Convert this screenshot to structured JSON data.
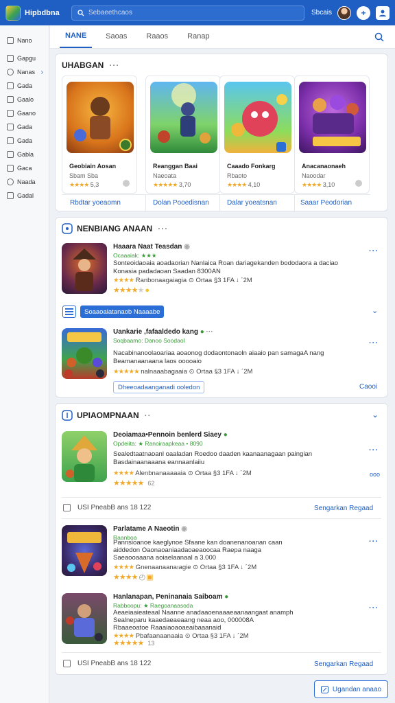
{
  "header": {
    "brand": "Hipbdbna",
    "search_placeholder": "Sebaeethcaos",
    "user_name": "Sbcais",
    "plus_label": "+"
  },
  "sidebar": {
    "items": [
      {
        "label": "Nano",
        "icon": "grid-icon"
      },
      {
        "label": "Gapgu",
        "icon": "folder-icon"
      },
      {
        "label": "Nanas",
        "icon": "circle-icon",
        "active": true
      },
      {
        "label": "Gada",
        "icon": "list-icon"
      },
      {
        "label": "Gaalo",
        "icon": "doc-icon"
      },
      {
        "label": "Gaano",
        "icon": "doc-icon"
      },
      {
        "label": "Gada",
        "icon": "edit-icon"
      },
      {
        "label": "Gada",
        "icon": "bookmark-icon"
      },
      {
        "label": "Gabla",
        "icon": "doc-icon"
      },
      {
        "label": "Gaca",
        "icon": "doc-icon"
      },
      {
        "label": "Naada",
        "icon": "circle-icon"
      },
      {
        "label": "Gadal",
        "icon": "list-icon"
      }
    ]
  },
  "tabs": [
    {
      "label": "NANE",
      "active": true
    },
    {
      "label": "Saoas"
    },
    {
      "label": "Raaos"
    },
    {
      "label": "Ranap"
    }
  ],
  "featured": {
    "title": "UHABGAN",
    "cards": [
      {
        "name": "Geobiain Aosan",
        "sub": "Sbam Sba",
        "rating": "5,3",
        "link": "Rbdtar yoeaomn"
      },
      {
        "name": "Reanggan Baai",
        "sub": "Naeoata",
        "rating": "3,70",
        "link": "Dolan Pooedisnan"
      },
      {
        "name": "Caaado Fonkarg",
        "sub": "Rbaoto",
        "rating": "4,10",
        "link": "Dalar yoeatsnan"
      },
      {
        "name": "Anacanaonaeh",
        "sub": "Naoodar",
        "rating": "3,10",
        "link": "Saaar Peodorian"
      }
    ]
  },
  "section2": {
    "title": "NENBIANG ANAAN",
    "item1": {
      "title": "Haaara Naat Teasdan",
      "dev": "Ocaaaiak: ★★★",
      "desc1": "Sonteoidaoaia aoadaorian Nanlaica Roan dariagekanden bododaora a daciao",
      "desc2": "Konasia padadaoan Saadan 8300AN",
      "meta": "Ranbonaagaiagia  ⊙ Ortaa  §3 1FA  ↓ ´2M"
    },
    "chip": "Soaaoaiatanaob Naaaabe",
    "item2": {
      "title": "Uankarie ,fafaaldedo kang",
      "dev": "Soqbaamo:  Danoo Soodaol",
      "desc1": "Nacabinanoolaoariaa aoaonog dodaontonaoln aiaaio pan samagaA nang",
      "desc2": "Beamanaanaana laos ooooaio",
      "meta": "nalnaaabagaaia  ⊙ Ortaa  §3 1FA  ↓ ´2M"
    },
    "chip2": "Dheeoadaanganadi ooledon",
    "link": "Caooi"
  },
  "section3": {
    "title": "UPIAOMPNAAN",
    "item1": {
      "title": "Deoiamaa•Pennoin benlerd Siaey",
      "dev": "Opdeiita: ★ Ranoiraapkeaa • 8090",
      "desc1": "Sealedtaatnaoanl oaaladan Roedoo daaden kaanaanagaan paingian",
      "desc2": "Basdainaanaaana eannaanlaiiu",
      "meta": "Alenbnanaaaaaia  ⊙ Ortaa  §3 1FA  ↓ ´2M",
      "extra": "62"
    },
    "foot1": "USI PneabB ans 18 122",
    "foot1_link": "Sengarkan Regaad",
    "item2": {
      "title": "Parlatame A Naeotin",
      "dev": "Raanboa",
      "desc1": "Pannsioanoe kaeglynoe Sfaane kan doanenanoanan caan",
      "desc2": "aiddedon Oaonaoaniaadaoaeaoocaa Raepa naaga",
      "desc3": "Saeaooaaana aoiaelaanaal a 3.000",
      "meta": "Gnenaanaanaıagie  ⊙ Ortaa  §3 1FA  ↓ ´2M"
    },
    "item3": {
      "title": "Hanlanapan, Peninanaia Saiboam",
      "dev": "Rabboopu: ★ Raegoanaasoda",
      "desc1": "Aeaeiaaieateaal Naanne anadaaoenaaaeaanaangaat anamph",
      "desc2": "Sealneparu kaaedaeaeaang neaa aoo, 000008A",
      "desc3": "Rbaaeoatoe Raaaiaoaoaeaibaaanaid",
      "meta": "Pbafaanaanaaia  ⊙ Ortaa  §3 1FA  ↓ ´2M",
      "extra": "13"
    },
    "foot2": "USI PneabB ans 18 122",
    "foot2_link": "Sengarkan Regaad"
  },
  "bottom_button": "Ugandan anaao",
  "colors": {
    "accent": "#1f5fc4",
    "star": "#f0a92b",
    "dev_green": "#3a9a3a"
  }
}
